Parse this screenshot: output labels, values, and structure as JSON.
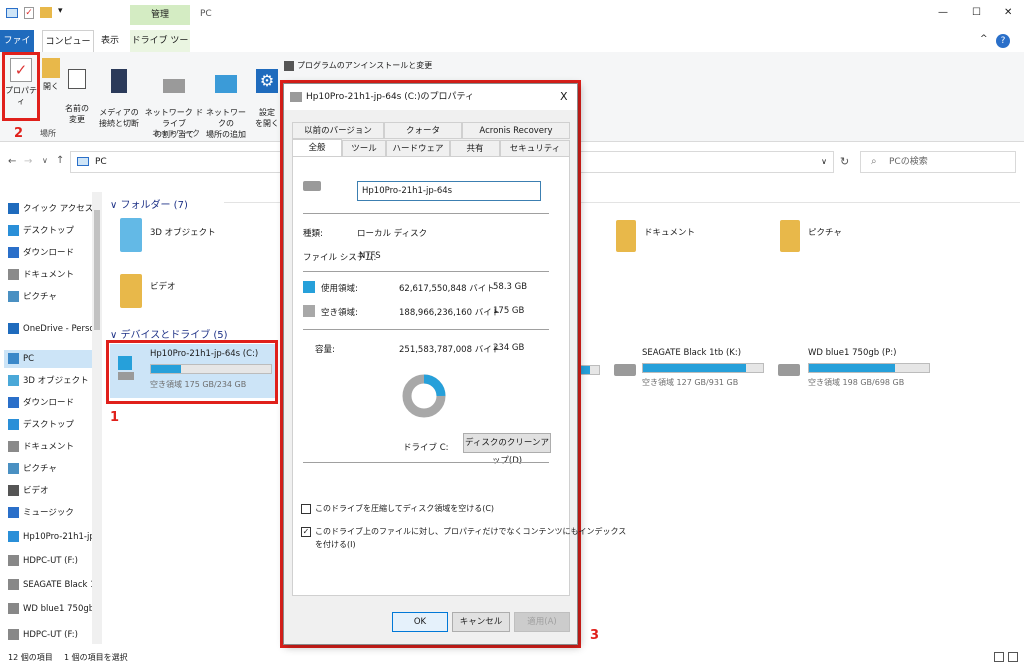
{
  "window": {
    "path_title": "PC",
    "manage_tab": "管理",
    "controls": {
      "minimize": "—",
      "maximize": "☐",
      "close": "✕"
    }
  },
  "ribbon_tabs": {
    "file": "ファイル",
    "computer": "コンピューター",
    "view": "表示",
    "drive_tools": "ドライブ ツール"
  },
  "ribbon": {
    "properties": "プロパティ",
    "open": "開く",
    "rename": "名前の\n変更",
    "media_access": "メディアの\n接続と切断",
    "map_network_drive": "ネットワーク ドライブ\nの割り当て",
    "add_network_location": "ネットワークの\n場所の追加",
    "settings": "設定\nを開く",
    "uninstall": "プログラムのアンインストールと変更",
    "group_location": "場所",
    "group_network": "ネットワーク"
  },
  "address": {
    "path": "PC",
    "search_placeholder": "PCの検索"
  },
  "nav": {
    "items": [
      {
        "label": "クイック アクセス",
        "icon": "star-icon",
        "color": "#1f6bbd"
      },
      {
        "label": "デスクトップ",
        "icon": "desktop-icon",
        "color": "#2a8fd8"
      },
      {
        "label": "ダウンロード",
        "icon": "download-icon",
        "color": "#2a6fc9"
      },
      {
        "label": "ドキュメント",
        "icon": "document-icon",
        "color": "#8a8a8a"
      },
      {
        "label": "ピクチャ",
        "icon": "picture-icon",
        "color": "#4a90c2"
      },
      {
        "label": "OneDrive - Person",
        "icon": "cloud-icon",
        "color": "#1f6bbd"
      },
      {
        "label": "PC",
        "icon": "pc-icon",
        "color": "#3b88c9"
      },
      {
        "label": "3D オブジェクト",
        "icon": "cube-icon",
        "color": "#4aa8d8"
      },
      {
        "label": "ダウンロード",
        "icon": "download-icon",
        "color": "#2a6fc9"
      },
      {
        "label": "デスクトップ",
        "icon": "desktop-icon",
        "color": "#2a8fd8"
      },
      {
        "label": "ドキュメント",
        "icon": "document-icon",
        "color": "#8a8a8a"
      },
      {
        "label": "ピクチャ",
        "icon": "picture-icon",
        "color": "#4a90c2"
      },
      {
        "label": "ビデオ",
        "icon": "video-icon",
        "color": "#555"
      },
      {
        "label": "ミュージック",
        "icon": "music-icon",
        "color": "#2a6fc9"
      },
      {
        "label": "Hp10Pro-21h1-jp",
        "icon": "drive-icon",
        "color": "#2a8fd8"
      },
      {
        "label": "HDPC-UT (F:)",
        "icon": "drive-icon",
        "color": "#888"
      },
      {
        "label": "SEAGATE Black 1",
        "icon": "drive-icon",
        "color": "#888"
      },
      {
        "label": "WD blue1 750gb",
        "icon": "drive-icon",
        "color": "#888"
      },
      {
        "label": "HDPC-UT (F:)",
        "icon": "drive-icon",
        "color": "#888"
      }
    ]
  },
  "main": {
    "folders_header": "フォルダー (7)",
    "folders": [
      "3D オブジェクト",
      "ビデオ",
      "ドキュメント",
      "ピクチャ"
    ],
    "drives_header": "デバイスとドライブ (5)",
    "drives": [
      {
        "name": "Hp10Pro-21h1-jp-64s (C:)",
        "free": "空き領域 175 GB/234 GB",
        "used_fraction": 0.25
      },
      {
        "name": "SEAGATE Black 1tb (K:)",
        "free": "空き領域 127 GB/931 GB",
        "used_fraction": 0.86
      },
      {
        "name": "WD blue1 750gb (P:)",
        "free": "空き領域 198 GB/698 GB",
        "used_fraction": 0.72
      }
    ]
  },
  "status": {
    "count": "12 個の項目",
    "selected": "1 個の項目を選択"
  },
  "annotations": {
    "n1": "1",
    "n2": "2",
    "n3": "3",
    "highlight_color": "#e0201b"
  },
  "dialog": {
    "title": "Hp10Pro-21h1-jp-64s (C:)のプロパティ",
    "close": "X",
    "tabs_row1": [
      "以前のバージョン",
      "クォータ",
      "Acronis Recovery"
    ],
    "tabs_row2": [
      "全般",
      "ツール",
      "ハードウェア",
      "共有",
      "セキュリティ"
    ],
    "drive_name_value": "Hp10Pro-21h1-jp-64s",
    "type_label": "種類:",
    "type_value": "ローカル ディスク",
    "fs_label": "ファイル システム:",
    "fs_value": "NTFS",
    "used_label": "使用領域:",
    "used_bytes": "62,617,550,848 バイト",
    "used_gb": "58.3 GB",
    "free_label": "空き領域:",
    "free_bytes": "188,966,236,160 バイト",
    "free_gb": "175 GB",
    "capacity_label": "容量:",
    "capacity_bytes": "251,583,787,008 バイト",
    "capacity_gb": "234 GB",
    "drive_letter": "ドライブ C:",
    "cleanup_button": "ディスクのクリーンアップ(D)",
    "compress_label": "このドライブを圧縮してディスク領域を空ける(C)",
    "index_label_1": "このドライブ上のファイルに対し、プロパティだけでなくコンテンツにもインデックス",
    "index_label_2": "を付ける(I)",
    "ok": "OK",
    "cancel": "キャンセル",
    "apply": "適用(A)",
    "used_fraction": 0.249,
    "used_color": "#26a0da",
    "free_color": "#a8a8a8"
  }
}
